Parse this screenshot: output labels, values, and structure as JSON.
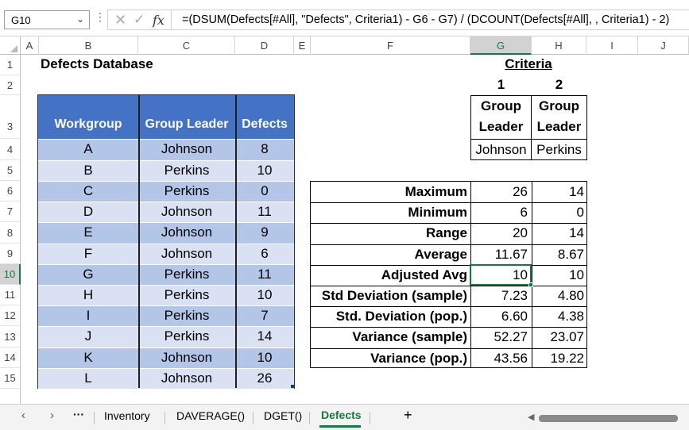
{
  "formula_bar": {
    "name_box": "G10",
    "formula": "=(DSUM(Defects[#All], \"Defects\", Criteria1) - G6 - G7) / (DCOUNT(Defects[#All], , Criteria1) - 2)"
  },
  "columns": [
    "A",
    "B",
    "C",
    "D",
    "E",
    "F",
    "G",
    "H",
    "I",
    "J"
  ],
  "rows": [
    "1",
    "2",
    "3",
    "4",
    "5",
    "6",
    "7",
    "8",
    "9",
    "10",
    "11",
    "12",
    "13",
    "14",
    "15"
  ],
  "selected_cell": {
    "column": "G",
    "row": "10"
  },
  "database": {
    "title": "Defects Database",
    "headers": [
      "Workgroup",
      "Group Leader",
      "Defects"
    ],
    "rows": [
      [
        "A",
        "Johnson",
        "8"
      ],
      [
        "B",
        "Perkins",
        "10"
      ],
      [
        "C",
        "Perkins",
        "0"
      ],
      [
        "D",
        "Johnson",
        "11"
      ],
      [
        "E",
        "Johnson",
        "9"
      ],
      [
        "F",
        "Johnson",
        "6"
      ],
      [
        "G",
        "Perkins",
        "11"
      ],
      [
        "H",
        "Perkins",
        "10"
      ],
      [
        "I",
        "Perkins",
        "7"
      ],
      [
        "J",
        "Perkins",
        "14"
      ],
      [
        "K",
        "Johnson",
        "10"
      ],
      [
        "L",
        "Johnson",
        "26"
      ]
    ]
  },
  "criteria": {
    "title": "Criteria",
    "numbers": [
      "1",
      "2"
    ],
    "header_line1": [
      "Group",
      "Group"
    ],
    "header_line2": [
      "Leader",
      "Leader"
    ],
    "values": [
      "Johnson",
      "Perkins"
    ]
  },
  "stats": [
    {
      "label": "Maximum",
      "g": "26",
      "h": "14"
    },
    {
      "label": "Minimum",
      "g": "6",
      "h": "0"
    },
    {
      "label": "Range",
      "g": "20",
      "h": "14"
    },
    {
      "label": "Average",
      "g": "11.67",
      "h": "8.67"
    },
    {
      "label": "Adjusted Avg",
      "g": "10",
      "h": "10"
    },
    {
      "label": "Std Deviation (sample)",
      "g": "7.23",
      "h": "4.80"
    },
    {
      "label": "Std. Deviation (pop.)",
      "g": "6.60",
      "h": "4.38"
    },
    {
      "label": "Variance (sample)",
      "g": "52.27",
      "h": "23.07"
    },
    {
      "label": "Variance (pop.)",
      "g": "43.56",
      "h": "19.22"
    }
  ],
  "sheet_tabs": {
    "more": "···",
    "tabs": [
      "Inventory",
      "DAVERAGE()",
      "DGET()",
      "Defects"
    ],
    "active": "Defects",
    "add": "+"
  },
  "colors": {
    "header_blue": "#4472c4",
    "band_dark": "#b4c6e7",
    "band_light": "#d9e1f2",
    "excel_green": "#107c41"
  }
}
